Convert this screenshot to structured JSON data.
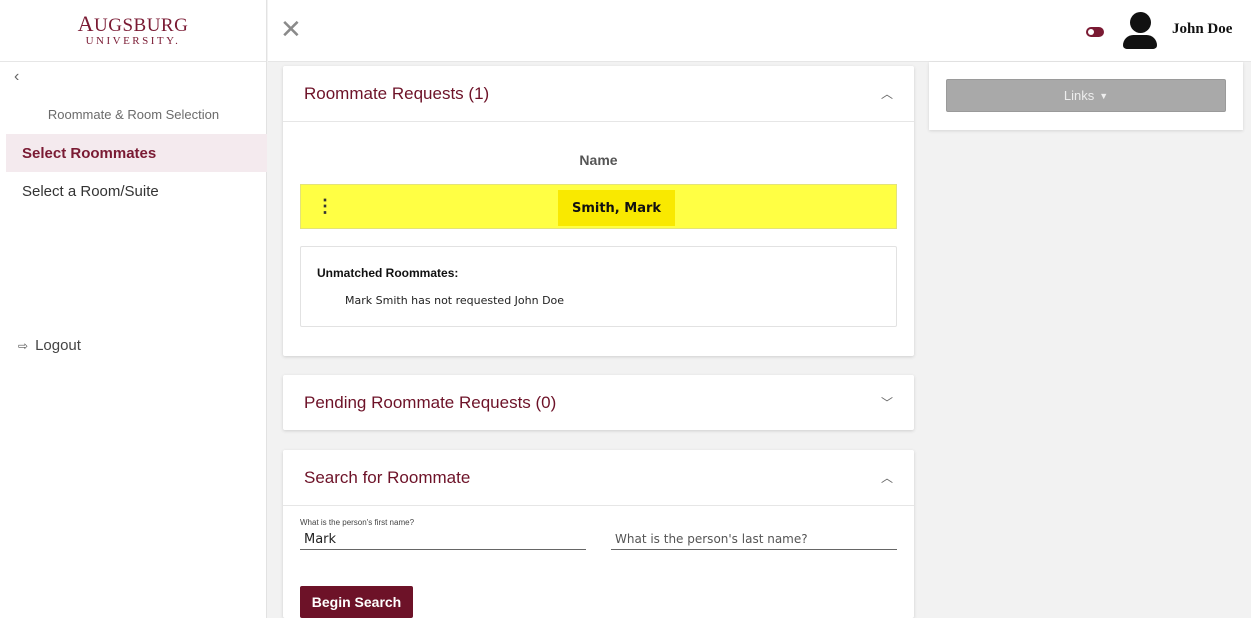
{
  "logo": {
    "first": "A",
    "rest": "UGSBURG",
    "sub": "UNIVERSITY."
  },
  "sidebar": {
    "section_title": "Roommate & Room Selection",
    "items": [
      {
        "label": "Select Roommates",
        "active": true
      },
      {
        "label": "Select a Room/Suite",
        "active": false
      }
    ],
    "logout_label": "Logout"
  },
  "header": {
    "user_name": "John Doe"
  },
  "roommate_requests": {
    "title": "Roommate Requests (1)",
    "column_header": "Name",
    "rows": [
      {
        "name": "Smith, Mark"
      }
    ],
    "unmatched_title": "Unmatched Roommates:",
    "unmatched_line": "Mark Smith has not requested John Doe"
  },
  "pending_requests": {
    "title": "Pending Roommate Requests (0)"
  },
  "search": {
    "title": "Search for Roommate",
    "first_name_label": "What is the person's first name?",
    "first_name_value": "Mark",
    "last_name_placeholder": "What is the person's last name?",
    "button_label": "Begin Search"
  },
  "right_panel": {
    "links_label": "Links"
  },
  "colors": {
    "brand": "#6d1228",
    "highlight": "#ffff44"
  }
}
